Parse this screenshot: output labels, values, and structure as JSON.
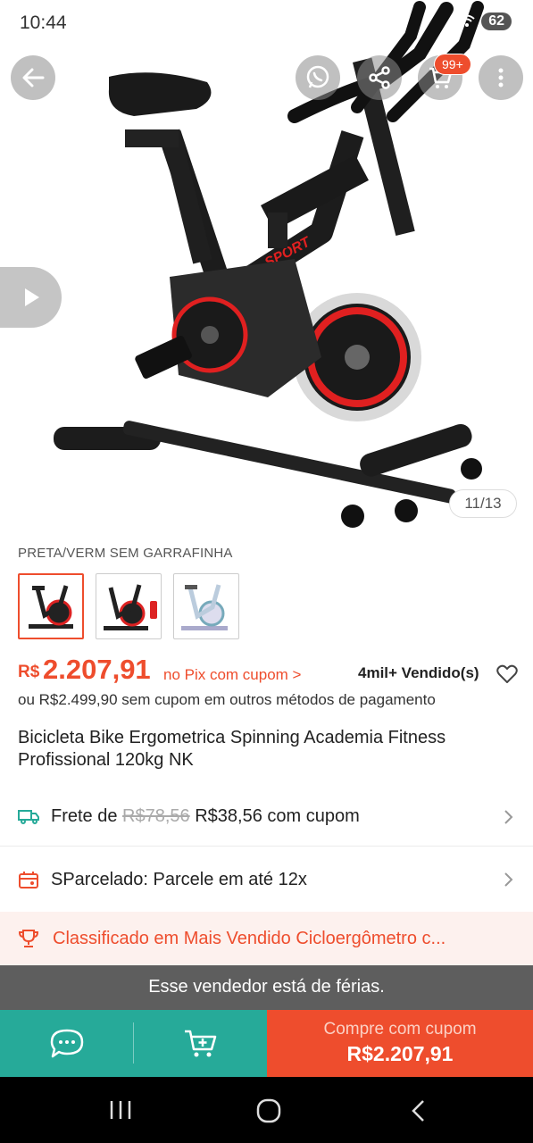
{
  "status_bar": {
    "time": "10:44",
    "battery": "62"
  },
  "gallery": {
    "counter": "11/13"
  },
  "cart": {
    "badge": "99+"
  },
  "variant": {
    "label": "PRETA/VERM SEM GARRAFINHA",
    "options": [
      "preta-vermelha",
      "preta-garrafinha",
      "branca-azul"
    ]
  },
  "price": {
    "currency": "R$",
    "value": "2.207,91",
    "pix_note": "no Pix com cupom >",
    "sold": "4mil+ Vendido(s)",
    "alt_text": "ou R$2.499,90 sem cupom em outros métodos de pagamento"
  },
  "product": {
    "title": "Bicicleta Bike Ergometrica Spinning Academia Fitness Profissional 120kg NK"
  },
  "shipping": {
    "prefix": "Frete de",
    "old_price": "R$78,56",
    "new_price": "R$38,56 com cupom"
  },
  "installments": {
    "text": "SParcelado: Parcele em até 12x"
  },
  "ranking": {
    "text": "Classificado em Mais Vendido Cicloergômetro c..."
  },
  "vacation": {
    "text": "Esse vendedor está de férias."
  },
  "actions": {
    "buy_label": "Compre com cupom",
    "buy_price": "R$2.207,91"
  },
  "colors": {
    "accent": "#ee4d2d",
    "teal": "#26aa99",
    "banner_bg": "#fdf1ee"
  },
  "icons": [
    "back-arrow-icon",
    "whatsapp-icon",
    "share-icon",
    "cart-icon",
    "more-vertical-icon",
    "play-icon",
    "heart-icon",
    "truck-icon",
    "installment-icon",
    "trophy-icon",
    "chat-icon",
    "add-to-cart-icon"
  ]
}
